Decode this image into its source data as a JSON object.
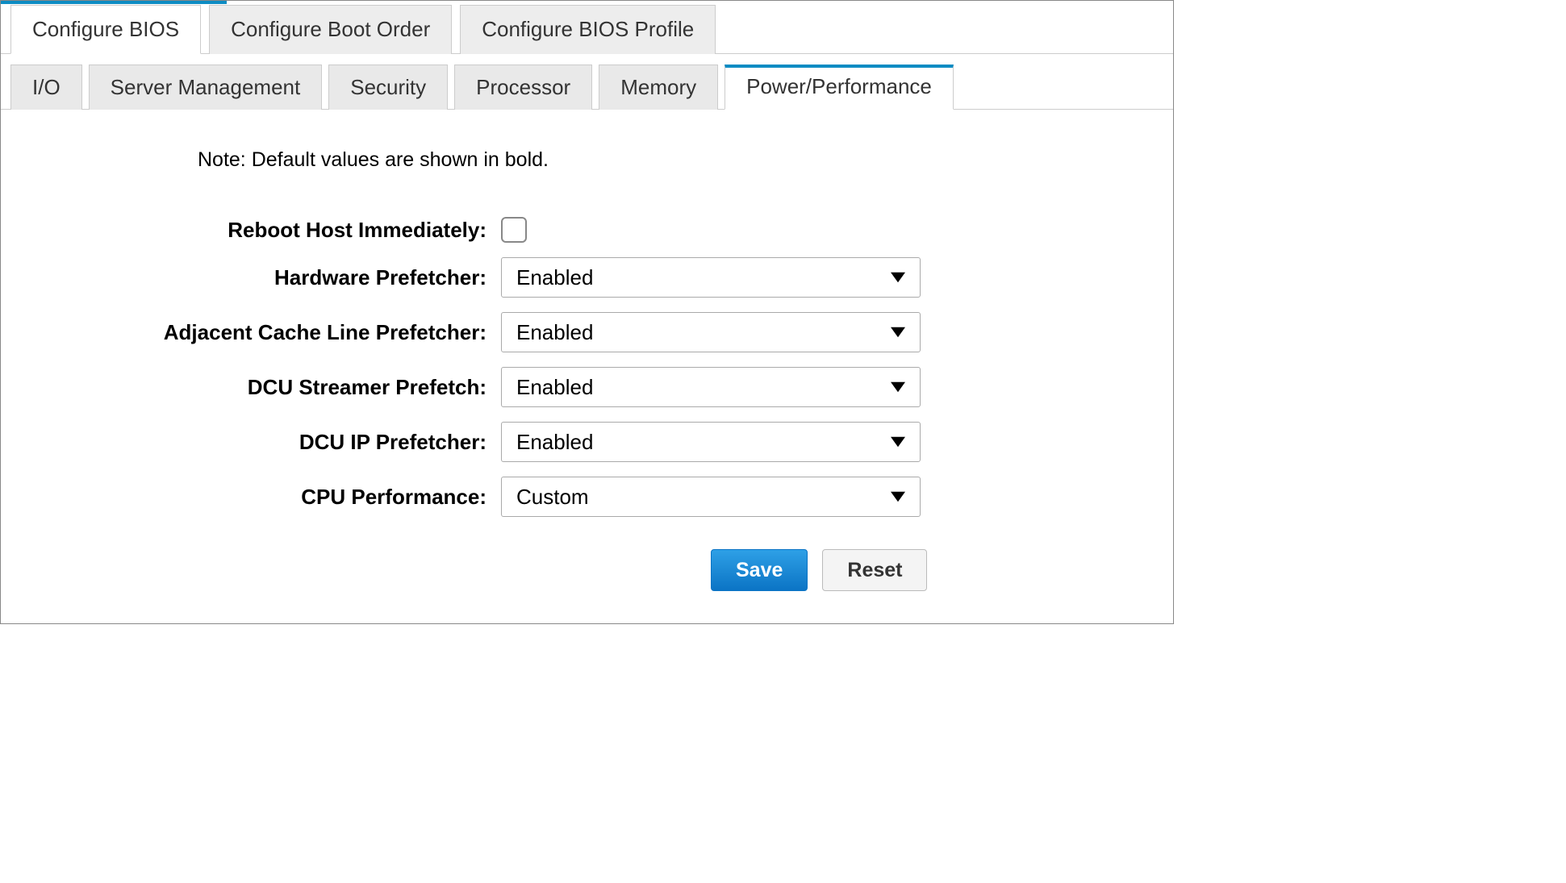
{
  "topTabs": [
    {
      "label": "Configure BIOS",
      "active": true
    },
    {
      "label": "Configure Boot Order",
      "active": false
    },
    {
      "label": "Configure BIOS Profile",
      "active": false
    }
  ],
  "subTabs": [
    {
      "label": "I/O",
      "active": false
    },
    {
      "label": "Server Management",
      "active": false
    },
    {
      "label": "Security",
      "active": false
    },
    {
      "label": "Processor",
      "active": false
    },
    {
      "label": "Memory",
      "active": false
    },
    {
      "label": "Power/Performance",
      "active": true
    }
  ],
  "note": "Note: Default values are shown in bold.",
  "form": {
    "rebootHost": {
      "label": "Reboot Host Immediately:",
      "checked": false
    },
    "hardwarePrefetcher": {
      "label": "Hardware Prefetcher:",
      "value": "Enabled"
    },
    "adjacentCache": {
      "label": "Adjacent Cache Line Prefetcher:",
      "value": "Enabled"
    },
    "dcuStreamer": {
      "label": "DCU Streamer Prefetch:",
      "value": "Enabled"
    },
    "dcuIp": {
      "label": "DCU IP Prefetcher:",
      "value": "Enabled"
    },
    "cpuPerf": {
      "label": "CPU Performance:",
      "value": "Custom"
    }
  },
  "buttons": {
    "save": "Save",
    "reset": "Reset"
  }
}
